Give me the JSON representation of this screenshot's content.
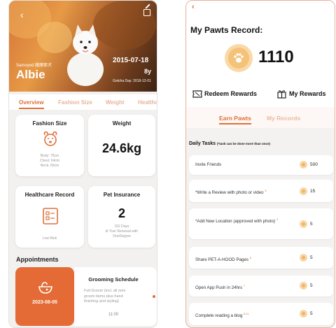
{
  "left": {
    "pet": {
      "breed": "Samoyed 薩摩耶犬",
      "name": "Albie",
      "birth_date": "2015-07-18",
      "age": "8y",
      "gotcha_day": "Gotcha Day: 2019-12-01"
    },
    "tabs": [
      "Overview",
      "Fashion Size",
      "Weight",
      "Healthc"
    ],
    "fashion_size": {
      "title": "Fashion Size",
      "body": "Body: 75cm",
      "chest": "Chest: 64cm",
      "neck": "Neck: 60cm"
    },
    "weight": {
      "title": "Weight",
      "value": "24.6kg"
    },
    "healthcare": {
      "title": "Healthcare Record",
      "status": "Low Risk"
    },
    "insurance": {
      "title": "Pet Insurance",
      "value": "2",
      "days": "152 Days",
      "renewal_1": "til Your Renewal with",
      "renewal_2": "OneDegree"
    },
    "appointments": {
      "heading": "Appointments",
      "date": "2023-08-05",
      "title": "Grooming Schedule",
      "desc_1": "Full Groom (incl. all mini",
      "desc_2": "groom items plus hand",
      "desc_3": "finishing and styling)",
      "time": "11:00"
    }
  },
  "right": {
    "title": "My Pawts Record:",
    "points": "1110",
    "redeem_label": "Redeem Rewards",
    "my_rewards_label": "My Rewards",
    "tabs": [
      "Earn Pawts",
      "My Records"
    ],
    "daily_title": "Daily Tasks",
    "daily_note": "(*task can be done more than once)",
    "tasks": [
      {
        "label": "Invite Friends",
        "sup": "",
        "points": "500"
      },
      {
        "label": "*Write a Review with photo or video",
        "sup": "3",
        "points": "15"
      },
      {
        "label": "*Add New Location (approved with photo)",
        "sup": "4",
        "points": "5"
      },
      {
        "label": "Share PET-A-HOOD Pages",
        "sup": "6",
        "points": "5"
      },
      {
        "label": "Open App Push in 24hrs",
        "sup": "7",
        "points": "5"
      },
      {
        "label": "Complete reading a blog",
        "sup": "8 11",
        "points": "5"
      }
    ]
  },
  "colors": {
    "accent": "#e0703a",
    "accent_light": "#edb9a0",
    "coin": "#f5c27a"
  }
}
